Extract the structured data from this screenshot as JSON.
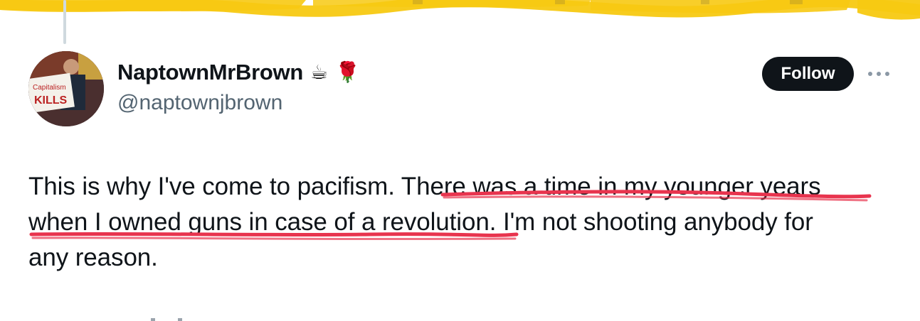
{
  "tweet": {
    "author": {
      "display_name": "NaptownMrBrown",
      "handle": "@naptownjbrown",
      "name_emojis": [
        "☕",
        "🌹"
      ],
      "avatar_sign_text": "Capitalism KILLS"
    },
    "follow_label": "Follow",
    "more_icon": "ellipsis-icon",
    "text_lines": [
      "This is why I've come to pacifism. There was a time in my younger years",
      "when I owned guns in case of a revolution. I'm not shooting anybody for",
      "any reason."
    ]
  },
  "annotations": {
    "top_highlight_color": "#f7c912",
    "underline_color": "#e8344e"
  }
}
